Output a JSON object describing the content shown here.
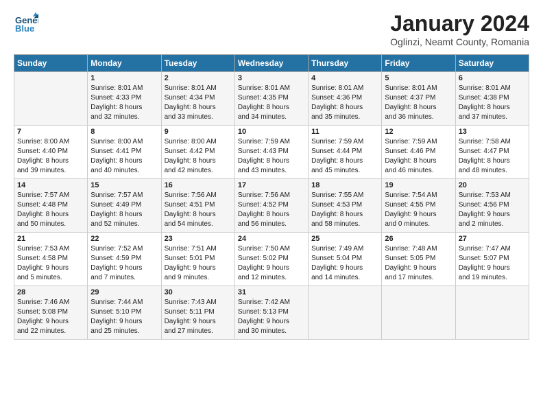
{
  "header": {
    "logo_line1": "General",
    "logo_line2": "Blue",
    "month_title": "January 2024",
    "location": "Oglinzi, Neamt County, Romania"
  },
  "days_of_week": [
    "Sunday",
    "Monday",
    "Tuesday",
    "Wednesday",
    "Thursday",
    "Friday",
    "Saturday"
  ],
  "weeks": [
    [
      {
        "day": "",
        "text": ""
      },
      {
        "day": "1",
        "text": "Sunrise: 8:01 AM\nSunset: 4:33 PM\nDaylight: 8 hours\nand 32 minutes."
      },
      {
        "day": "2",
        "text": "Sunrise: 8:01 AM\nSunset: 4:34 PM\nDaylight: 8 hours\nand 33 minutes."
      },
      {
        "day": "3",
        "text": "Sunrise: 8:01 AM\nSunset: 4:35 PM\nDaylight: 8 hours\nand 34 minutes."
      },
      {
        "day": "4",
        "text": "Sunrise: 8:01 AM\nSunset: 4:36 PM\nDaylight: 8 hours\nand 35 minutes."
      },
      {
        "day": "5",
        "text": "Sunrise: 8:01 AM\nSunset: 4:37 PM\nDaylight: 8 hours\nand 36 minutes."
      },
      {
        "day": "6",
        "text": "Sunrise: 8:01 AM\nSunset: 4:38 PM\nDaylight: 8 hours\nand 37 minutes."
      }
    ],
    [
      {
        "day": "7",
        "text": "Sunrise: 8:00 AM\nSunset: 4:40 PM\nDaylight: 8 hours\nand 39 minutes."
      },
      {
        "day": "8",
        "text": "Sunrise: 8:00 AM\nSunset: 4:41 PM\nDaylight: 8 hours\nand 40 minutes."
      },
      {
        "day": "9",
        "text": "Sunrise: 8:00 AM\nSunset: 4:42 PM\nDaylight: 8 hours\nand 42 minutes."
      },
      {
        "day": "10",
        "text": "Sunrise: 7:59 AM\nSunset: 4:43 PM\nDaylight: 8 hours\nand 43 minutes."
      },
      {
        "day": "11",
        "text": "Sunrise: 7:59 AM\nSunset: 4:44 PM\nDaylight: 8 hours\nand 45 minutes."
      },
      {
        "day": "12",
        "text": "Sunrise: 7:59 AM\nSunset: 4:46 PM\nDaylight: 8 hours\nand 46 minutes."
      },
      {
        "day": "13",
        "text": "Sunrise: 7:58 AM\nSunset: 4:47 PM\nDaylight: 8 hours\nand 48 minutes."
      }
    ],
    [
      {
        "day": "14",
        "text": "Sunrise: 7:57 AM\nSunset: 4:48 PM\nDaylight: 8 hours\nand 50 minutes."
      },
      {
        "day": "15",
        "text": "Sunrise: 7:57 AM\nSunset: 4:49 PM\nDaylight: 8 hours\nand 52 minutes."
      },
      {
        "day": "16",
        "text": "Sunrise: 7:56 AM\nSunset: 4:51 PM\nDaylight: 8 hours\nand 54 minutes."
      },
      {
        "day": "17",
        "text": "Sunrise: 7:56 AM\nSunset: 4:52 PM\nDaylight: 8 hours\nand 56 minutes."
      },
      {
        "day": "18",
        "text": "Sunrise: 7:55 AM\nSunset: 4:53 PM\nDaylight: 8 hours\nand 58 minutes."
      },
      {
        "day": "19",
        "text": "Sunrise: 7:54 AM\nSunset: 4:55 PM\nDaylight: 9 hours\nand 0 minutes."
      },
      {
        "day": "20",
        "text": "Sunrise: 7:53 AM\nSunset: 4:56 PM\nDaylight: 9 hours\nand 2 minutes."
      }
    ],
    [
      {
        "day": "21",
        "text": "Sunrise: 7:53 AM\nSunset: 4:58 PM\nDaylight: 9 hours\nand 5 minutes."
      },
      {
        "day": "22",
        "text": "Sunrise: 7:52 AM\nSunset: 4:59 PM\nDaylight: 9 hours\nand 7 minutes."
      },
      {
        "day": "23",
        "text": "Sunrise: 7:51 AM\nSunset: 5:01 PM\nDaylight: 9 hours\nand 9 minutes."
      },
      {
        "day": "24",
        "text": "Sunrise: 7:50 AM\nSunset: 5:02 PM\nDaylight: 9 hours\nand 12 minutes."
      },
      {
        "day": "25",
        "text": "Sunrise: 7:49 AM\nSunset: 5:04 PM\nDaylight: 9 hours\nand 14 minutes."
      },
      {
        "day": "26",
        "text": "Sunrise: 7:48 AM\nSunset: 5:05 PM\nDaylight: 9 hours\nand 17 minutes."
      },
      {
        "day": "27",
        "text": "Sunrise: 7:47 AM\nSunset: 5:07 PM\nDaylight: 9 hours\nand 19 minutes."
      }
    ],
    [
      {
        "day": "28",
        "text": "Sunrise: 7:46 AM\nSunset: 5:08 PM\nDaylight: 9 hours\nand 22 minutes."
      },
      {
        "day": "29",
        "text": "Sunrise: 7:44 AM\nSunset: 5:10 PM\nDaylight: 9 hours\nand 25 minutes."
      },
      {
        "day": "30",
        "text": "Sunrise: 7:43 AM\nSunset: 5:11 PM\nDaylight: 9 hours\nand 27 minutes."
      },
      {
        "day": "31",
        "text": "Sunrise: 7:42 AM\nSunset: 5:13 PM\nDaylight: 9 hours\nand 30 minutes."
      },
      {
        "day": "",
        "text": ""
      },
      {
        "day": "",
        "text": ""
      },
      {
        "day": "",
        "text": ""
      }
    ]
  ]
}
